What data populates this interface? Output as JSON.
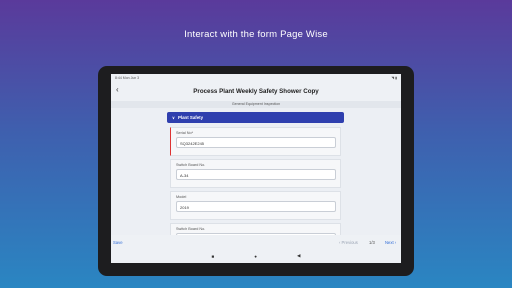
{
  "headline": "Interact with the form Page Wise",
  "status_bar": {
    "time": "8:44  Mon Jun 3",
    "icons": "◥ ▮"
  },
  "app_bar": {
    "title": "Process Plant Weekly Safety Shower Copy",
    "back_icon": "chevron-left-icon"
  },
  "subtitle": "General Equipment Inspection",
  "section": {
    "label": "Plant Safety",
    "icon": "chevron-down-icon",
    "color": "#2f3fae"
  },
  "fields": [
    {
      "label": "Serial No*",
      "value": "SQ3242E245"
    },
    {
      "label": "Switch Board No.",
      "value": "A-34"
    },
    {
      "label": "Model",
      "value": "2019"
    },
    {
      "label": "Switch Board No.",
      "value": ""
    }
  ],
  "footer": {
    "save": "Save",
    "previous": "‹ Previous",
    "page": "1/3",
    "next": "Next ›"
  },
  "nav": {
    "square": "■",
    "home": "●",
    "back": "◀"
  },
  "colors": {
    "accent": "#2f6bd6",
    "error": "#d33"
  }
}
